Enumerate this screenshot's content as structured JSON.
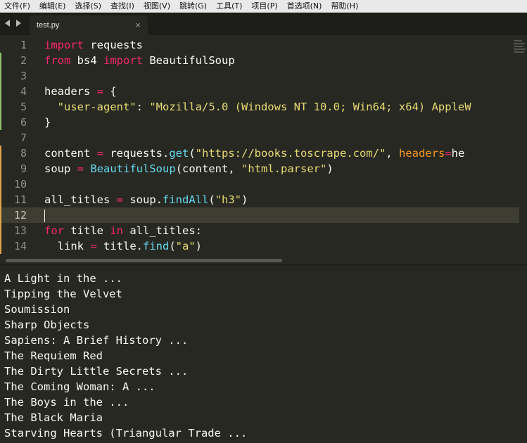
{
  "menu": [
    "文件(F)",
    "编辑(E)",
    "选择(S)",
    "查找(I)",
    "视图(V)",
    "跳转(G)",
    "工具(T)",
    "项目(P)",
    "首选项(N)",
    "帮助(H)"
  ],
  "tab": {
    "filename": "test.py",
    "close": "×"
  },
  "editor": {
    "current_line": 12,
    "lines": [
      {
        "n": "1",
        "change": "none",
        "text": "import requests"
      },
      {
        "n": "2",
        "change": "added",
        "text": "from bs4 import BeautifulSoup"
      },
      {
        "n": "3",
        "change": "added",
        "text": ""
      },
      {
        "n": "4",
        "change": "added",
        "text": "headers = {"
      },
      {
        "n": "5",
        "change": "added",
        "text": "  \"user-agent\": \"Mozilla/5.0 (Windows NT 10.0; Win64; x64) AppleW"
      },
      {
        "n": "6",
        "change": "added",
        "text": "}"
      },
      {
        "n": "7",
        "change": "none",
        "text": ""
      },
      {
        "n": "8",
        "change": "modified",
        "text": "content = requests.get(\"https://books.toscrape.com/\", headers=he"
      },
      {
        "n": "9",
        "change": "modified",
        "text": "soup = BeautifulSoup(content, \"html.parser\")"
      },
      {
        "n": "10",
        "change": "modified",
        "text": ""
      },
      {
        "n": "11",
        "change": "modified",
        "text": "all_titles = soup.findAll(\"h3\")"
      },
      {
        "n": "12",
        "change": "modified",
        "text": ""
      },
      {
        "n": "13",
        "change": "modified",
        "text": "for title in all_titles:"
      },
      {
        "n": "14",
        "change": "modified",
        "text": "  link = title.find(\"a\")"
      }
    ]
  },
  "output": {
    "lines": [
      "A Light in the ...",
      "Tipping the Velvet",
      "Soumission",
      "Sharp Objects",
      "Sapiens: A Brief History ...",
      "The Requiem Red",
      "The Dirty Little Secrets ...",
      "The Coming Woman: A ...",
      "The Boys in the ...",
      "The Black Maria",
      "Starving Hearts (Triangular Trade ..."
    ]
  },
  "colors": {
    "background": "#272822",
    "keyword": "#f92672",
    "string": "#e6db74",
    "function": "#66d9ef",
    "parameter": "#fd971f",
    "added_marker": "#8fc16a",
    "modified_marker": "#e0a549"
  }
}
